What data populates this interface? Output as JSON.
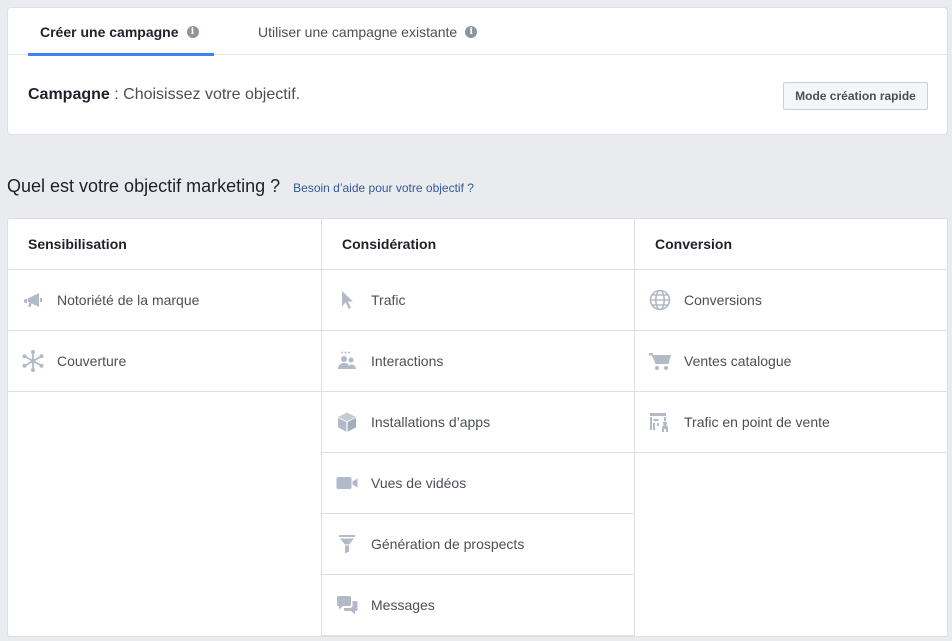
{
  "tabs": {
    "create": "Créer une campagne",
    "existing": "Utiliser une campagne existante",
    "info_glyph": "i"
  },
  "campaign": {
    "label": "Campagne",
    "separator": " : ",
    "text": "Choisissez votre objectif."
  },
  "quick_mode_label": "Mode création rapide",
  "question": {
    "title": "Quel est votre objectif marketing ?",
    "help_link": "Besoin d’aide pour votre objectif ?"
  },
  "columns": [
    {
      "title": "Sensibilisation",
      "items": [
        {
          "label": "Notoriété de la marque",
          "icon": "megaphone-icon"
        },
        {
          "label": "Couverture",
          "icon": "reach-icon"
        }
      ]
    },
    {
      "title": "Considération",
      "items": [
        {
          "label": "Trafic",
          "icon": "cursor-icon"
        },
        {
          "label": "Interactions",
          "icon": "people-icon"
        },
        {
          "label": "Installations d’apps",
          "icon": "box-icon"
        },
        {
          "label": "Vues de vidéos",
          "icon": "video-camera-icon"
        },
        {
          "label": "Génération de prospects",
          "icon": "funnel-icon"
        },
        {
          "label": "Messages",
          "icon": "chat-bubbles-icon"
        }
      ]
    },
    {
      "title": "Conversion",
      "items": [
        {
          "label": "Conversions",
          "icon": "globe-icon"
        },
        {
          "label": "Ventes catalogue",
          "icon": "cart-icon"
        },
        {
          "label": "Trafic en point de vente",
          "icon": "store-icon"
        }
      ]
    }
  ],
  "colors": {
    "icon": "#b3bac7",
    "accent": "#4080ff",
    "link": "#365899"
  }
}
